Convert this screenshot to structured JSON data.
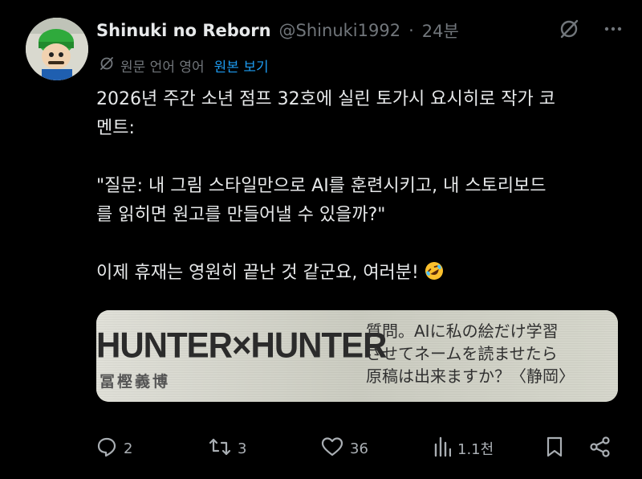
{
  "post": {
    "display_name": "Shinuki no Reborn",
    "handle": "@Shinuki1992",
    "separator": "·",
    "time": "24분"
  },
  "translation": {
    "label": "원문 언어 영어",
    "link": "원본 보기"
  },
  "body": {
    "line1": "2026년 주간 소년 점프 32호에 실린 토가시 요시히로 작가 코",
    "line2": "멘트:",
    "line3": "\"질문: 내 그림 스타일만으로 AI를 훈련시키고, 내 스토리보드",
    "line4": "를 읽히면 원고를 만들어낼 수 있을까?\"",
    "line5": "이제 휴재는 영원히 끝난 것 같군요, 여러분!",
    "emoji": "rolling-on-floor-laughing"
  },
  "media": {
    "title": "HUNTER×HUNTER",
    "author": "冨樫義博",
    "jp_line1": "質問。AIに私の絵だけ学習",
    "jp_line2": "させてネームを読ませたら",
    "jp_line3": "原稿は出来ますか？〈静岡〉"
  },
  "actions": {
    "replies": "2",
    "reposts": "3",
    "likes": "36",
    "views": "1.1천"
  },
  "icons": {
    "grok": "grok-icon",
    "more": "more-icon",
    "translate": "translate-icon",
    "reply": "reply-icon",
    "repost": "repost-icon",
    "like": "heart-icon",
    "views": "views-icon",
    "bookmark": "bookmark-icon",
    "share": "share-icon"
  },
  "colors": {
    "background": "#000000",
    "text": "#e7e9ea",
    "secondary": "#71767b",
    "link": "#1d9bf0"
  }
}
